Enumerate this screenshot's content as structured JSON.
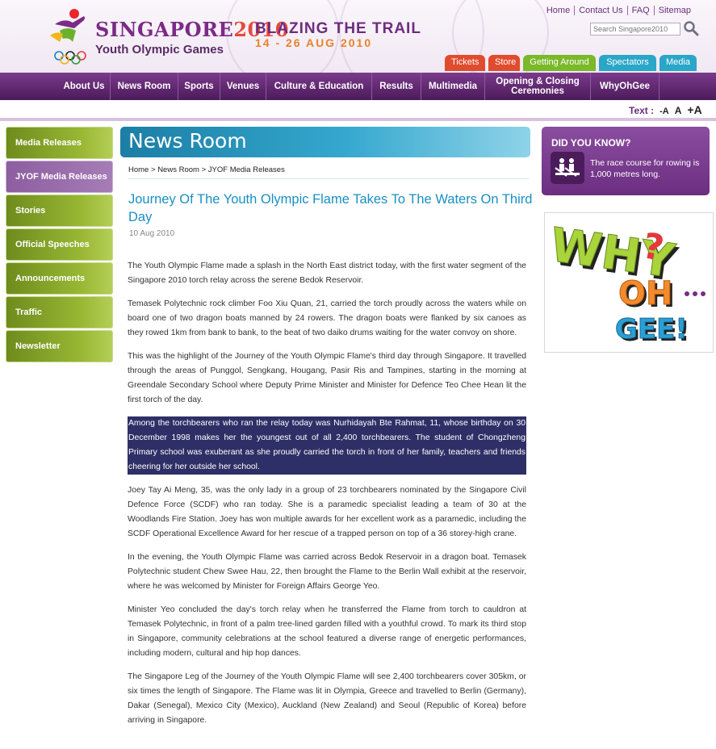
{
  "header": {
    "logo_brand": "SINGAPORE",
    "logo_year": "2010",
    "logo_subtitle": "Youth Olympic Games",
    "tagline": "BLAZING THE TRAIL",
    "dates": "14 - 26 AUG 2010",
    "top_links": [
      "Home",
      "Contact Us",
      "FAQ",
      "Sitemap"
    ],
    "search_placeholder": "Search Singapore2010",
    "quick_tabs": [
      {
        "label": "Tickets",
        "color": "#e04c2e"
      },
      {
        "label": "Store",
        "color": "#e04c2e"
      },
      {
        "label": "Getting Around",
        "color": "#7bb82a"
      },
      {
        "label": "Spectators",
        "color": "#2aa6c8"
      },
      {
        "label": "Media",
        "color": "#2aa6c8"
      }
    ]
  },
  "nav": {
    "items": [
      "About Us",
      "News Room",
      "Sports",
      "Venues",
      "Culture & Education",
      "Results",
      "Multimedia",
      "Opening & Closing Ceremonies",
      "WhyOhGee"
    ]
  },
  "text_size": {
    "label": "Text :",
    "options": [
      "-A",
      "A",
      "+A"
    ]
  },
  "sidebar": {
    "items": [
      "Media Releases",
      "JYOF Media Releases",
      "Stories",
      "Official Speeches",
      "Announcements",
      "Traffic",
      "Newsletter"
    ],
    "active_index": 1
  },
  "main": {
    "banner_title": "News Room",
    "breadcrumb": [
      "Home",
      "News Room",
      "JYOF Media Releases"
    ],
    "breadcrumb_separator": ">",
    "headline": "Journey Of The Youth Olympic Flame Takes To The Waters On Third Day",
    "date": "10 Aug 2010",
    "paragraphs": [
      "The Youth Olympic Flame made a splash in the North East district today, with the first water segment of the Singapore 2010 torch relay across the serene Bedok Reservoir.",
      "Temasek Polytechnic rock climber Foo Xiu Quan, 21, carried the torch proudly across the waters while on board one of two dragon boats manned by 24 rowers. The dragon boats were flanked by six canoes as they rowed 1km from bank to bank, to the beat of two daiko drums waiting for the water convoy on shore.",
      "This was the highlight of the Journey of the Youth Olympic Flame's third day through Singapore. It travelled through the areas of Punggol, Sengkang, Hougang, Pasir Ris and Tampines, starting in the morning at Greendale Secondary School where Deputy Prime Minister and Minister for Defence Teo Chee Hean lit the first torch of the day.",
      "Among the torchbearers who ran the relay today was Nurhidayah Bte Rahmat, 11, whose birthday on 30 December 1998 makes her the youngest out of all 2,400 torchbearers. The student of Chongzheng Primary school was exuberant as she proudly carried the torch in front of her family, teachers and friends cheering for her outside her school.",
      "Joey Tay Ai Meng, 35, was the only lady in a group of 23 torchbearers nominated by the Singapore Civil Defence Force (SCDF) who ran today. She is a paramedic specialist leading a team of 30 at the Woodlands Fire Station. Joey has won multiple awards for her excellent work as a paramedic, including the SCDF Operational Excellence Award for her rescue of a trapped person on top of a 36 storey-high crane.",
      "In the evening, the Youth Olympic Flame was carried across Bedok Reservoir in a dragon boat. Temasek Polytechnic student Chew Swee Hau, 22, then brought the Flame to the Berlin Wall exhibit at the reservoir, where he was welcomed by Minister for Foreign Affairs George Yeo.",
      "Minister Yeo concluded the day's torch relay when he transferred the Flame from torch to cauldron at Temasek Polytechnic, in front of a palm tree-lined garden filled with a youthful crowd. To mark its third stop in Singapore, community celebrations at the school featured a diverse range of energetic performances, including modern, cultural and hip hop dances.",
      "The Singapore Leg of the Journey of the Youth Olympic Flame will see 2,400 torchbearers cover 305km, or six times the length of Singapore. The Flame was lit in Olympia, Greece and travelled to Berlin (Germany), Dakar (Senegal), Mexico City (Mexico), Auckland (New Zealand) and Seoul (Republic of Korea) before arriving in Singapore."
    ],
    "highlighted_paragraph_index": 3
  },
  "right": {
    "dyk_title": "DID YOU KNOW?",
    "dyk_text": "The race course for rowing is 1,000 metres long.",
    "promo_words": [
      "WHY",
      "OH",
      "GEE!"
    ]
  }
}
